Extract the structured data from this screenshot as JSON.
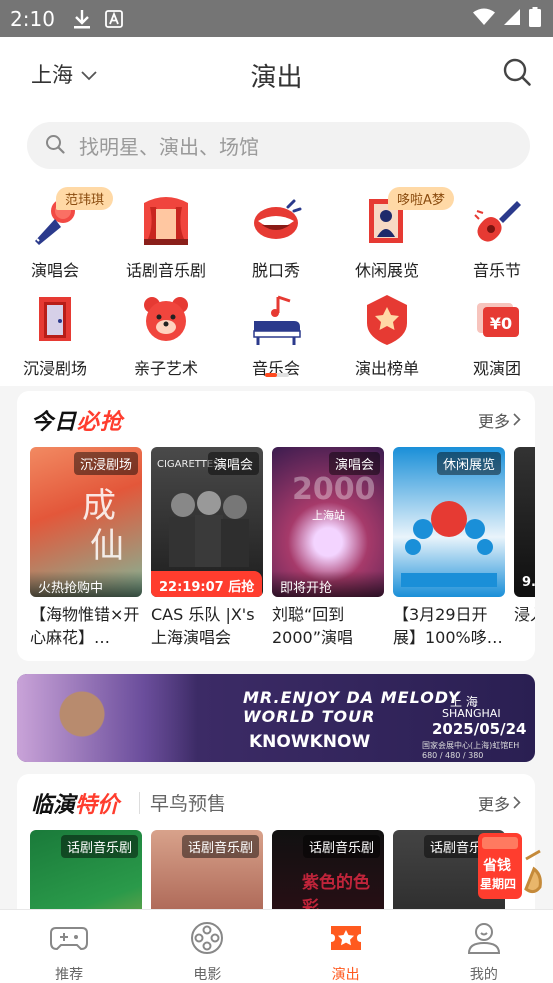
{
  "status_bar": {
    "time": "2:10"
  },
  "header": {
    "city": "上海",
    "title": "演出"
  },
  "search": {
    "placeholder": "找明星、演出、场馆"
  },
  "categories": [
    {
      "label": "演唱会",
      "badge": "范玮琪",
      "icon": "microphone-icon"
    },
    {
      "label": "话剧音乐剧",
      "icon": "theater-curtain-icon"
    },
    {
      "label": "脱口秀",
      "icon": "mouth-icon"
    },
    {
      "label": "休闲展览",
      "badge": "哆啦A梦",
      "icon": "painting-icon"
    },
    {
      "label": "音乐节",
      "icon": "guitar-icon"
    },
    {
      "label": "沉浸剧场",
      "icon": "door-icon"
    },
    {
      "label": "亲子艺术",
      "icon": "bear-icon"
    },
    {
      "label": "音乐会",
      "icon": "piano-icon"
    },
    {
      "label": "演出榜单",
      "icon": "ranking-badge-icon"
    },
    {
      "label": "观演团",
      "icon": "group-ticket-icon"
    }
  ],
  "today": {
    "title_a": "今日",
    "title_b": "必抢",
    "more": "更多",
    "items": [
      {
        "tag": "沉浸剧场",
        "status": "火热抢购中",
        "title": "【海物惟错×开心麻花】…",
        "colors": [
          "#e3573a",
          "#7fb89a"
        ]
      },
      {
        "tag": "演唱会",
        "countdown": "22:19:07 后抢",
        "title": "CAS 乐队 |X's 上海演唱会",
        "colors": [
          "#1d1d1d",
          "#4a4a4a"
        ],
        "poster_text": "CIGARETTES"
      },
      {
        "tag": "演唱会",
        "status": "即将开抢",
        "title": "刘聪“回到2000”演唱会…",
        "colors": [
          "#3b1c4f",
          "#a63a6a"
        ],
        "poster_text": "上海站"
      },
      {
        "tag": "休闲展览",
        "title": "【3月29日开展】100%哆…",
        "colors": [
          "#1a8fd8",
          "#e9f4fb"
        ]
      },
      {
        "title": "浸入《神…",
        "colors": [
          "#0f0f0f",
          "#333333"
        ],
        "poster_text": "9."
      }
    ]
  },
  "banner": {
    "title": "MR.ENJOY DA MELODY WORLD TOUR",
    "subtitle": "KNOWKNOW",
    "city_cn": "上  海",
    "city_en": "SHANGHAI",
    "date": "2025/05/24",
    "venue": "国家会展中心(上海)虹馆EH 680 / 480 / 380"
  },
  "second": {
    "title_a": "临演",
    "title_b": "特价",
    "sub": "早鸟预售",
    "more": "更多",
    "items": [
      {
        "tag": "话剧音乐剧",
        "colors": [
          "#1a7a3a",
          "#d1b24a"
        ]
      },
      {
        "tag": "话剧音乐剧",
        "colors": [
          "#8c3a2e",
          "#d8a28b"
        ]
      },
      {
        "tag": "话剧音乐剧",
        "colors": [
          "#111111",
          "#c0243a"
        ],
        "poster_text": "紫色的色彩"
      },
      {
        "tag": "话剧音乐剧",
        "colors": [
          "#1d1d1d",
          "#444444"
        ]
      }
    ],
    "promo": {
      "line1": "省钱",
      "line2": "星期四"
    }
  },
  "bottom_nav": [
    {
      "label": "推荐",
      "icon": "game-controller-icon",
      "active": false
    },
    {
      "label": "电影",
      "icon": "film-reel-icon",
      "active": false
    },
    {
      "label": "演出",
      "icon": "star-ticket-icon",
      "active": true
    },
    {
      "label": "我的",
      "icon": "user-icon",
      "active": false
    }
  ],
  "colors": {
    "accent": "#ff4a1f",
    "brand_red": "#ff3d2e"
  }
}
